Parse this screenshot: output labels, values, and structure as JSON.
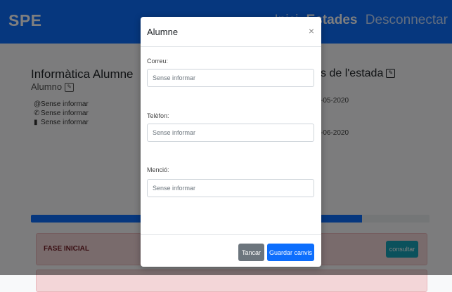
{
  "navbar": {
    "brand": "SPE",
    "links": [
      {
        "label": "Inici",
        "active": false
      },
      {
        "label": "Estades",
        "active": true
      },
      {
        "label": "Desconnectar",
        "active": false
      }
    ]
  },
  "student": {
    "name": "Informàtica Alumne",
    "role": "Alumno",
    "email": "Sense informar",
    "phone": "Sense informar",
    "mention": "Sense informar"
  },
  "stay": {
    "title_partial": "s de l'estada",
    "date_start_partial": "-05-2020",
    "date_end_partial": "-06-2020"
  },
  "progress": {
    "value_fraction": 0.83
  },
  "phases": [
    {
      "label": "FASE INICIAL",
      "action": "consultar"
    }
  ],
  "modal": {
    "title": "Alumne",
    "close_symbol": "×",
    "fields": {
      "email": {
        "label": "Correu:",
        "placeholder": "Sense informar",
        "value": ""
      },
      "phone": {
        "label": "Telèfon:",
        "placeholder": "Sense informar",
        "value": ""
      },
      "mention": {
        "label": "Menció:",
        "placeholder": "Sense informar",
        "value": ""
      }
    },
    "buttons": {
      "close": "Tancar",
      "save": "Guardar canvis"
    }
  },
  "colors": {
    "primary": "#0d6efd",
    "secondary": "#6c757d",
    "danger_bg": "#f3d6d8",
    "info": "#17a2b8"
  }
}
